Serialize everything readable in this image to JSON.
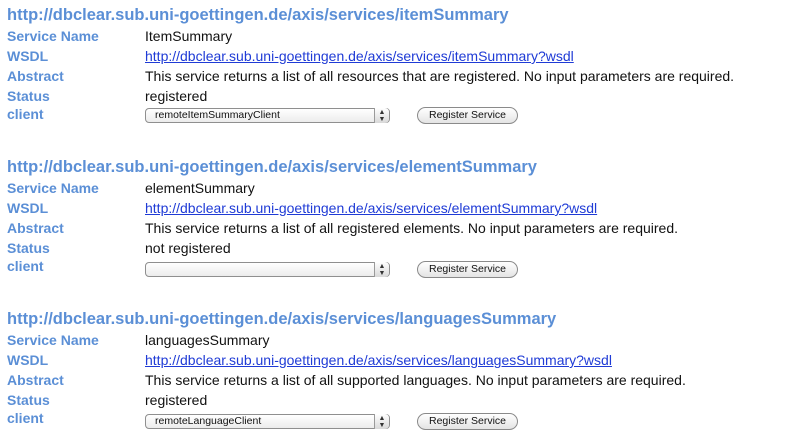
{
  "labels": {
    "service_name": "Service Name",
    "wsdl": "WSDL",
    "abstract": "Abstract",
    "status": "Status",
    "client": "client"
  },
  "services": [
    {
      "title": "http://dbclear.sub.uni-goettingen.de/axis/services/itemSummary",
      "service_name": "ItemSummary",
      "wsdl": "http://dbclear.sub.uni-goettingen.de/axis/services/itemSummary?wsdl",
      "abstract": "This service returns a list of all resources that are registered. No input parameters are required.",
      "status": "registered",
      "client_selected": "remoteItemSummaryClient",
      "button_label": "Register Service"
    },
    {
      "title": "http://dbclear.sub.uni-goettingen.de/axis/services/elementSummary",
      "service_name": "elementSummary",
      "wsdl": "http://dbclear.sub.uni-goettingen.de/axis/services/elementSummary?wsdl",
      "abstract": "This service returns a list of all registered elements. No input parameters are required.",
      "status": "not registered",
      "client_selected": "",
      "button_label": "Register Service"
    },
    {
      "title": "http://dbclear.sub.uni-goettingen.de/axis/services/languagesSummary",
      "service_name": "languagesSummary",
      "wsdl": "http://dbclear.sub.uni-goettingen.de/axis/services/languagesSummary?wsdl",
      "abstract": "This service returns a list of all supported languages. No input parameters are required.",
      "status": "registered",
      "client_selected": "remoteLanguageClient",
      "button_label": "Register Service"
    }
  ],
  "icons": {
    "select_arrows": "up-down-arrows-icon"
  }
}
